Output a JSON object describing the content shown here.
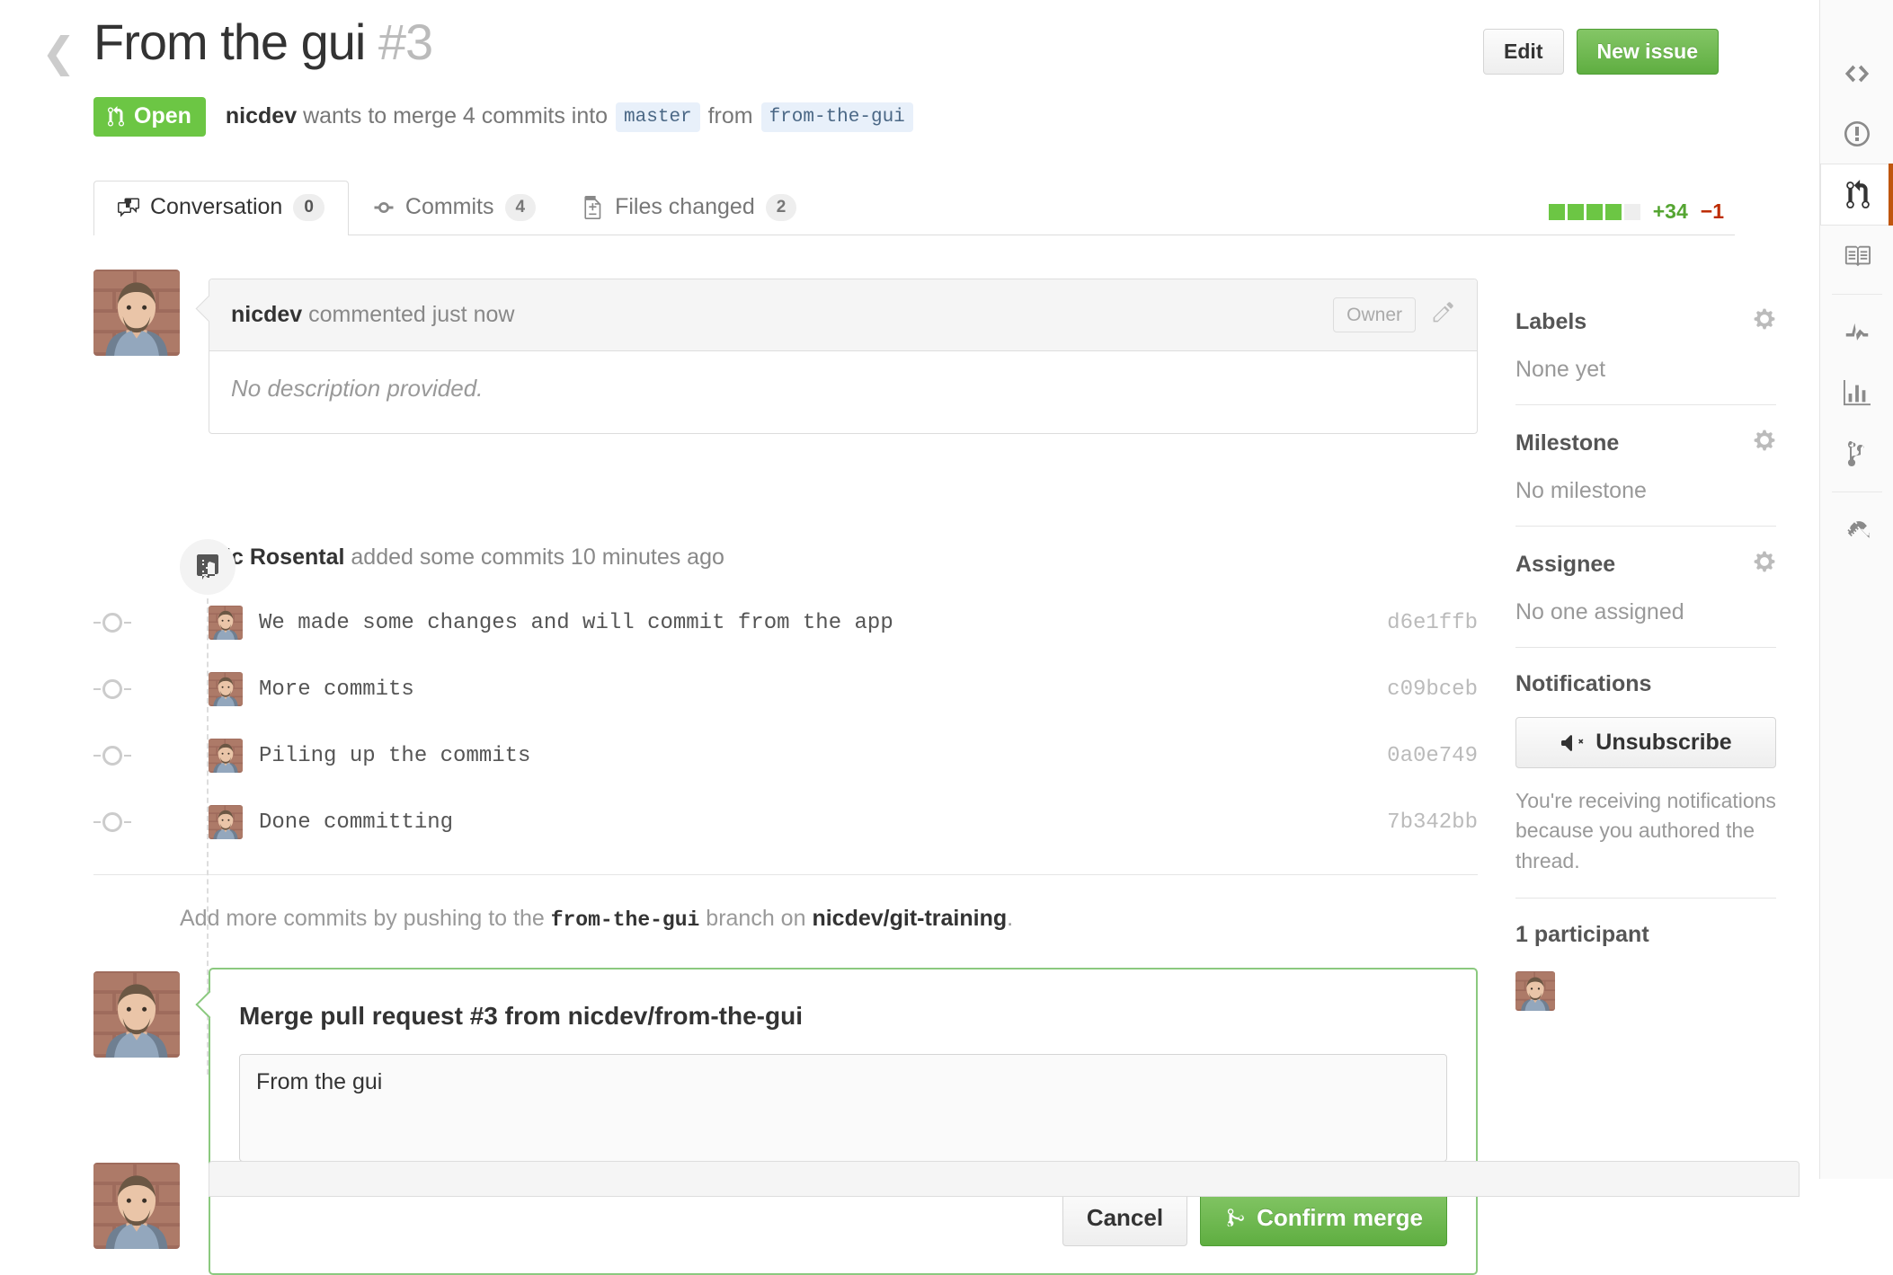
{
  "header": {
    "back_icon": "chevron-left-icon",
    "title": "From the gui",
    "issue_number": "#3",
    "edit_label": "Edit",
    "new_issue_label": "New issue"
  },
  "state": {
    "status_label": "Open",
    "status_icon": "git-pull-request-icon",
    "author": "nicdev",
    "text_before": "wants to merge 4 commits into",
    "base_branch": "master",
    "text_middle": "from",
    "head_branch": "from-the-gui"
  },
  "tabs": [
    {
      "label": "Conversation",
      "count": "0",
      "icon": "comment-discussion-icon",
      "active": true
    },
    {
      "label": "Commits",
      "count": "4",
      "icon": "git-commit-icon",
      "active": false
    },
    {
      "label": "Files changed",
      "count": "2",
      "icon": "diff-icon",
      "active": false
    }
  ],
  "diffstat": {
    "additions": "+34",
    "deletions": "−1",
    "blocks_filled": 4,
    "blocks_empty": 1,
    "add_color": "#55a532",
    "del_color": "#bd2c00"
  },
  "comment": {
    "author": "nicdev",
    "meta": "commented just now",
    "role_badge": "Owner",
    "edit_icon": "pencil-icon",
    "body": "No description provided."
  },
  "commits_event": {
    "icon": "repo-push-icon",
    "actor": "Nic Rosental",
    "text": "added some commits 10 minutes ago",
    "commits": [
      {
        "message": "We made some changes and will commit from the app",
        "sha": "d6e1ffb"
      },
      {
        "message": "More commits",
        "sha": "c09bceb"
      },
      {
        "message": "Piling up the commits",
        "sha": "0a0e749"
      },
      {
        "message": "Done committing",
        "sha": "7b342bb"
      }
    ]
  },
  "push_note": {
    "prefix": "Add more commits by pushing to the",
    "branch": "from-the-gui",
    "middle": "branch on",
    "repo": "nicdev/git-training",
    "suffix": "."
  },
  "merge": {
    "title": "Merge pull request #3 from nicdev/from-the-gui",
    "message_value": "From the gui",
    "message_placeholder": "",
    "cancel_label": "Cancel",
    "confirm_label": "Confirm merge",
    "confirm_icon": "git-merge-icon",
    "border_color": "#8bc97f"
  },
  "sidebar": {
    "labels": {
      "title": "Labels",
      "value": "None yet",
      "gear_icon": "gear-icon"
    },
    "milestone": {
      "title": "Milestone",
      "value": "No milestone",
      "gear_icon": "gear-icon"
    },
    "assignee": {
      "title": "Assignee",
      "value": "No one assigned",
      "gear_icon": "gear-icon"
    },
    "notifications": {
      "title": "Notifications",
      "button_label": "Unsubscribe",
      "button_icon": "mute-icon",
      "note": "You're receiving notifications because you authored the thread."
    },
    "participants": {
      "title": "1 participant"
    }
  },
  "rail": [
    {
      "icon": "code-icon",
      "active": false
    },
    {
      "icon": "issue-opened-icon",
      "active": false
    },
    {
      "icon": "git-pull-request-icon",
      "active": true
    },
    {
      "icon": "book-icon",
      "active": false
    },
    {
      "sep": true
    },
    {
      "icon": "pulse-icon",
      "active": false
    },
    {
      "icon": "graph-icon",
      "active": false
    },
    {
      "icon": "network-icon",
      "active": false
    },
    {
      "sep": true
    },
    {
      "icon": "tools-icon",
      "active": false
    }
  ],
  "colors": {
    "open_green": "#6cc644",
    "button_green": "#5fae41",
    "active_rail_orange": "#c0560f",
    "branch_badge_bg": "#e8f0fa",
    "branch_badge_text": "#4a6785"
  }
}
